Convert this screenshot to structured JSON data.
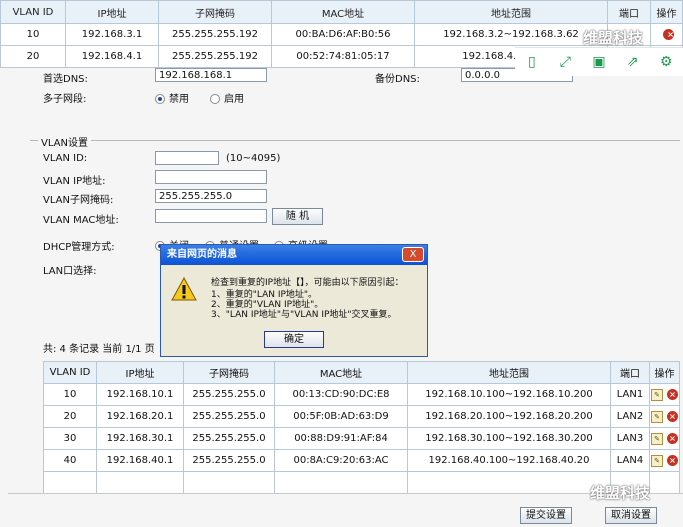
{
  "headers": [
    "VLAN ID",
    "IP地址",
    "子网掩码",
    "MAC地址",
    "地址范围",
    "端口",
    "操作"
  ],
  "top_rows": [
    {
      "id": "10",
      "ip": "192.168.3.1",
      "mask": "255.255.255.192",
      "mac": "00:BA:D6:AF:B0:56",
      "range": "192.168.3.2~192.168.3.62"
    },
    {
      "id": "20",
      "ip": "192.168.4.1",
      "mask": "255.255.255.192",
      "mac": "00:52:74:81:05:17",
      "range": "192.168.4.2~192.1"
    }
  ],
  "watermark": "维盟科技",
  "form": {
    "dns_label": "首选DNS:",
    "dns_value": "192.168.168.1",
    "dns2_label": "备份DNS:",
    "dns2_value": "0.0.0.0",
    "multi_subnet_label": "多子网段:",
    "multi_off": "禁用",
    "multi_on": "启用",
    "section_title": "VLAN设置",
    "vlan_id_label": "VLAN ID:",
    "vlan_id_value": "",
    "vlan_id_hint": "(10~4095)",
    "vlan_ip_label": "VLAN IP地址:",
    "vlan_ip_value": "",
    "vlan_mask_label": "VLAN子网掩码:",
    "vlan_mask_value": "255.255.255.0",
    "vlan_mac_label": "VLAN MAC地址:",
    "vlan_mac_value": "",
    "random_btn": "随 机",
    "dhcp_label": "DHCP管理方式:",
    "dhcp_opt1": "关闭",
    "dhcp_opt2": "普通设置",
    "dhcp_opt3": "高级设置",
    "lan_label": "LAN口选择:",
    "record_info": "共: 4 条记录 当前 1/1 页"
  },
  "dialog": {
    "title": "来自网页的消息",
    "close": "X",
    "line1": "检查到重复的IP地址【】，可能由以下原因引起：",
    "line2": "1、重复的\"LAN IP地址\"。",
    "line3": "2、重复的\"VLAN IP地址\"。",
    "line4": "3、\"LAN IP地址\"与\"VLAN IP地址\"交叉重复。",
    "ok": "确定"
  },
  "bottom_rows": [
    {
      "id": "10",
      "ip": "192.168.10.1",
      "mask": "255.255.255.0",
      "mac": "00:13:CD:90:DC:E8",
      "range": "192.168.10.100~192.168.10.200",
      "port": "LAN1"
    },
    {
      "id": "20",
      "ip": "192.168.20.1",
      "mask": "255.255.255.0",
      "mac": "00:5F:0B:AD:63:D9",
      "range": "192.168.20.100~192.168.20.200",
      "port": "LAN2"
    },
    {
      "id": "30",
      "ip": "192.168.30.1",
      "mask": "255.255.255.0",
      "mac": "00:88:D9:91:AF:84",
      "range": "192.168.30.100~192.168.30.200",
      "port": "LAN3"
    },
    {
      "id": "40",
      "ip": "192.168.40.1",
      "mask": "255.255.255.0",
      "mac": "00:8A:C9:20:63:AC",
      "range": "192.168.40.100~192.168.40.20",
      "port": "LAN4"
    }
  ],
  "buttons": {
    "submit": "提交设置",
    "cancel": "取消设置"
  },
  "colors": {
    "header_bg": "#e8f0f8",
    "dialog_title": "#0a52d6",
    "accent_green": "#1a9a4a"
  }
}
